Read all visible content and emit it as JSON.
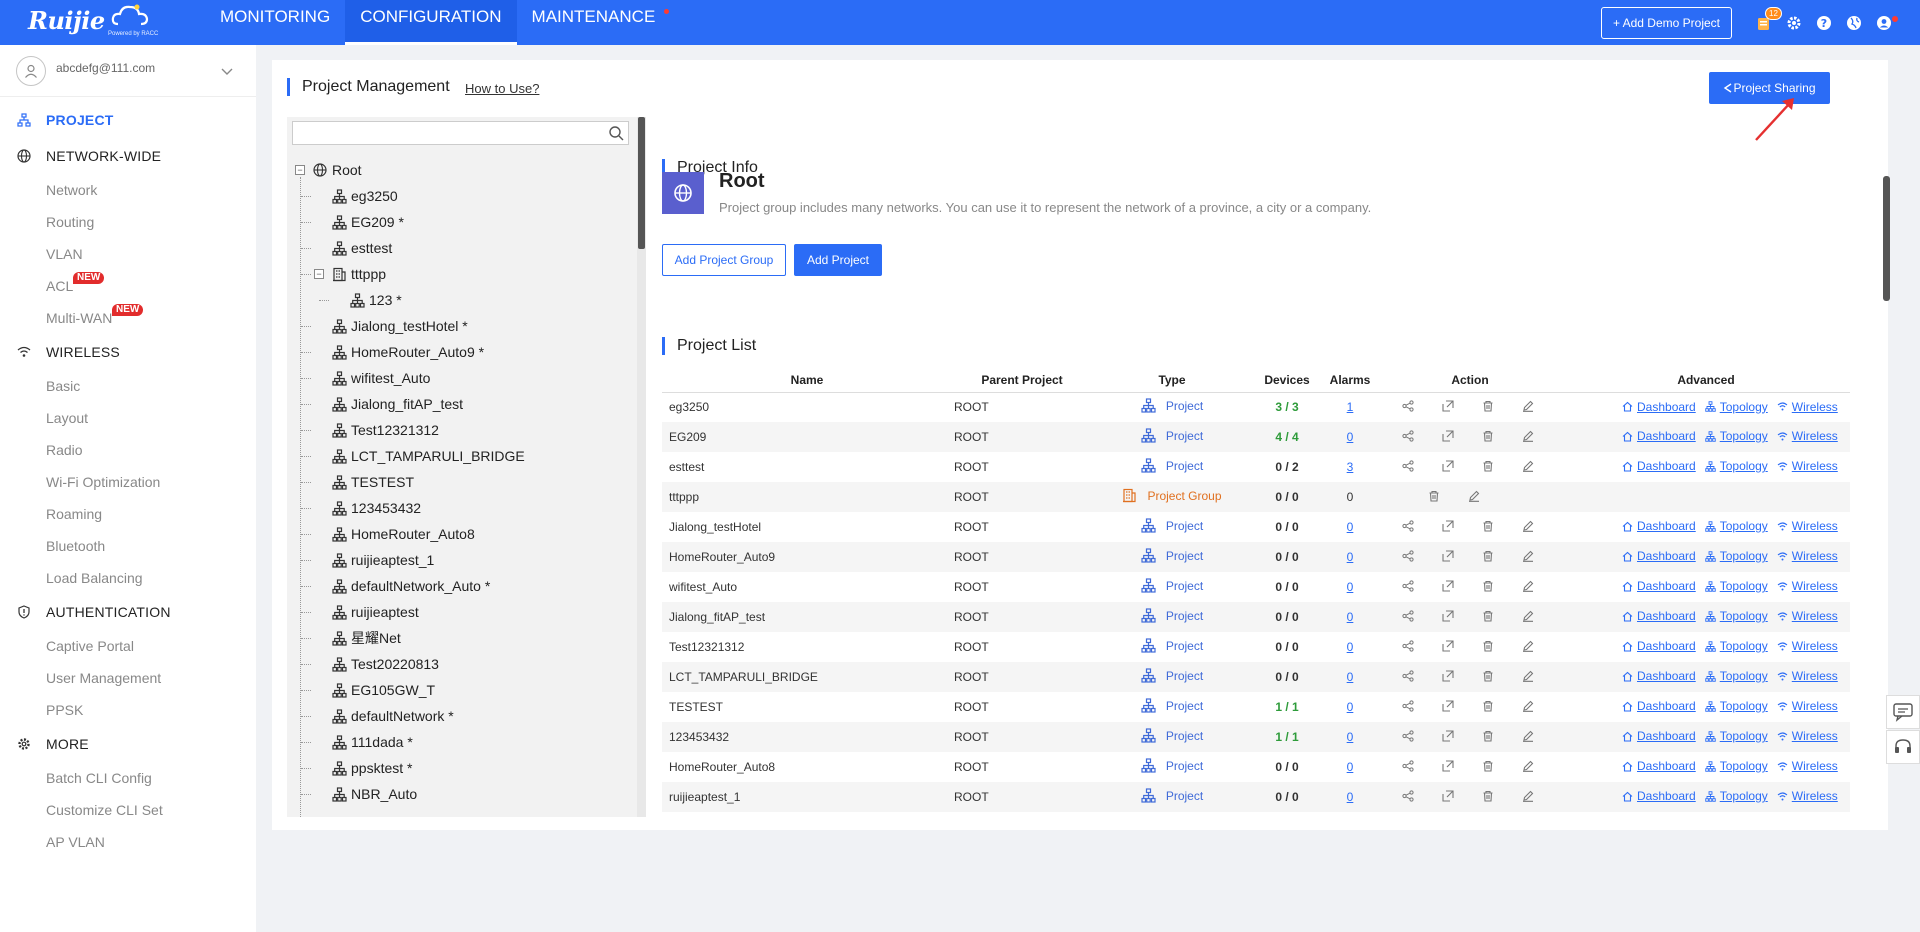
{
  "topbar": {
    "logo_text": "Ruijie",
    "logo_sub": "Powered by RACC",
    "nav": [
      {
        "label": "MONITORING",
        "active": false,
        "dot": false
      },
      {
        "label": "CONFIGURATION",
        "active": true,
        "dot": false
      },
      {
        "label": "MAINTENANCE",
        "active": false,
        "dot": true
      }
    ],
    "demo_button": "+ Add Demo Project",
    "notification_count": "12",
    "colors": {
      "primary": "#2b6cf6",
      "alert": "#ff3b30"
    }
  },
  "sidebar": {
    "account_email": "abcdefg@111.com",
    "sections": [
      {
        "label": "PROJECT",
        "icon": "project-icon",
        "active": true,
        "items": []
      },
      {
        "label": "NETWORK-WIDE",
        "icon": "globe-icon",
        "active": false,
        "items": [
          {
            "label": "Network"
          },
          {
            "label": "Routing"
          },
          {
            "label": "VLAN"
          },
          {
            "label": "ACL",
            "badge": "NEW"
          },
          {
            "label": "Multi-WAN",
            "badge": "NEW"
          }
        ]
      },
      {
        "label": "WIRELESS",
        "icon": "wifi-icon",
        "active": false,
        "items": [
          {
            "label": "Basic"
          },
          {
            "label": "Layout"
          },
          {
            "label": "Radio"
          },
          {
            "label": "Wi-Fi Optimization"
          },
          {
            "label": "Roaming"
          },
          {
            "label": "Bluetooth"
          },
          {
            "label": "Load Balancing"
          }
        ]
      },
      {
        "label": "AUTHENTICATION",
        "icon": "shield-icon",
        "active": false,
        "items": [
          {
            "label": "Captive Portal"
          },
          {
            "label": "User Management"
          },
          {
            "label": "PPSK"
          }
        ]
      },
      {
        "label": "MORE",
        "icon": "gear-icon",
        "active": false,
        "items": [
          {
            "label": "Batch CLI Config"
          },
          {
            "label": "Customize CLI Set"
          },
          {
            "label": "AP VLAN"
          }
        ]
      }
    ]
  },
  "main": {
    "title": "Project Management",
    "how_to": "How to Use?",
    "share_button": "Project Sharing",
    "tree": {
      "search_placeholder": "",
      "root": "Root",
      "nodes": [
        {
          "label": "eg3250",
          "level": 1,
          "kind": "project"
        },
        {
          "label": "EG209 *",
          "level": 1,
          "kind": "project"
        },
        {
          "label": "esttest",
          "level": 1,
          "kind": "project"
        },
        {
          "label": "tttppp",
          "level": 1,
          "kind": "group"
        },
        {
          "label": "123 *",
          "level": 2,
          "kind": "project"
        },
        {
          "label": "Jialong_testHotel *",
          "level": 1,
          "kind": "project"
        },
        {
          "label": "HomeRouter_Auto9 *",
          "level": 1,
          "kind": "project"
        },
        {
          "label": "wifitest_Auto",
          "level": 1,
          "kind": "project"
        },
        {
          "label": "Jialong_fitAP_test",
          "level": 1,
          "kind": "project"
        },
        {
          "label": "Test12321312",
          "level": 1,
          "kind": "project"
        },
        {
          "label": "LCT_TAMPARULI_BRIDGE",
          "level": 1,
          "kind": "project"
        },
        {
          "label": "TESTEST",
          "level": 1,
          "kind": "project"
        },
        {
          "label": "123453432",
          "level": 1,
          "kind": "project"
        },
        {
          "label": "HomeRouter_Auto8",
          "level": 1,
          "kind": "project"
        },
        {
          "label": "ruijieaptest_1",
          "level": 1,
          "kind": "project"
        },
        {
          "label": "defaultNetwork_Auto *",
          "level": 1,
          "kind": "project"
        },
        {
          "label": "ruijieaptest",
          "level": 1,
          "kind": "project"
        },
        {
          "label": "星耀Net",
          "level": 1,
          "kind": "project"
        },
        {
          "label": "Test20220813",
          "level": 1,
          "kind": "project"
        },
        {
          "label": "EG105GW_T",
          "level": 1,
          "kind": "project"
        },
        {
          "label": "defaultNetwork *",
          "level": 1,
          "kind": "project"
        },
        {
          "label": "111dada *",
          "level": 1,
          "kind": "project"
        },
        {
          "label": "ppsktest *",
          "level": 1,
          "kind": "project"
        },
        {
          "label": "NBR_Auto",
          "level": 1,
          "kind": "project"
        }
      ]
    },
    "info": {
      "title": "Project Info",
      "name": "Root",
      "description": "Project group includes many networks. You can use it to represent the network of a province, a city or a company.",
      "add_group_button": "Add Project Group",
      "add_project_button": "Add Project"
    },
    "list": {
      "title": "Project List",
      "columns": [
        "Name",
        "Parent Project",
        "Type",
        "Devices",
        "Alarms",
        "Action",
        "Advanced"
      ],
      "advanced_links": [
        "Dashboard",
        "Topology",
        "Wireless"
      ],
      "rows": [
        {
          "name": "eg3250",
          "parent": "ROOT",
          "type": "Project",
          "devices": "3 / 3",
          "alarms": "1",
          "group": false
        },
        {
          "name": "EG209",
          "parent": "ROOT",
          "type": "Project",
          "devices": "4 / 4",
          "alarms": "0",
          "group": false
        },
        {
          "name": "esttest",
          "parent": "ROOT",
          "type": "Project",
          "devices": "0 / 2",
          "alarms": "3",
          "group": false
        },
        {
          "name": "tttppp",
          "parent": "ROOT",
          "type": "Project Group",
          "devices": "0 / 0",
          "alarms": "0",
          "group": true
        },
        {
          "name": "Jialong_testHotel",
          "parent": "ROOT",
          "type": "Project",
          "devices": "0 / 0",
          "alarms": "0",
          "group": false
        },
        {
          "name": "HomeRouter_Auto9",
          "parent": "ROOT",
          "type": "Project",
          "devices": "0 / 0",
          "alarms": "0",
          "group": false
        },
        {
          "name": "wifitest_Auto",
          "parent": "ROOT",
          "type": "Project",
          "devices": "0 / 0",
          "alarms": "0",
          "group": false
        },
        {
          "name": "Jialong_fitAP_test",
          "parent": "ROOT",
          "type": "Project",
          "devices": "0 / 0",
          "alarms": "0",
          "group": false
        },
        {
          "name": "Test12321312",
          "parent": "ROOT",
          "type": "Project",
          "devices": "0 / 0",
          "alarms": "0",
          "group": false
        },
        {
          "name": "LCT_TAMPARULI_BRIDGE",
          "parent": "ROOT",
          "type": "Project",
          "devices": "0 / 0",
          "alarms": "0",
          "group": false
        },
        {
          "name": "TESTEST",
          "parent": "ROOT",
          "type": "Project",
          "devices": "1 / 1",
          "alarms": "0",
          "group": false
        },
        {
          "name": "123453432",
          "parent": "ROOT",
          "type": "Project",
          "devices": "1 / 1",
          "alarms": "0",
          "group": false
        },
        {
          "name": "HomeRouter_Auto8",
          "parent": "ROOT",
          "type": "Project",
          "devices": "0 / 0",
          "alarms": "0",
          "group": false
        },
        {
          "name": "ruijieaptest_1",
          "parent": "ROOT",
          "type": "Project",
          "devices": "0 / 0",
          "alarms": "0",
          "group": false
        }
      ]
    }
  }
}
